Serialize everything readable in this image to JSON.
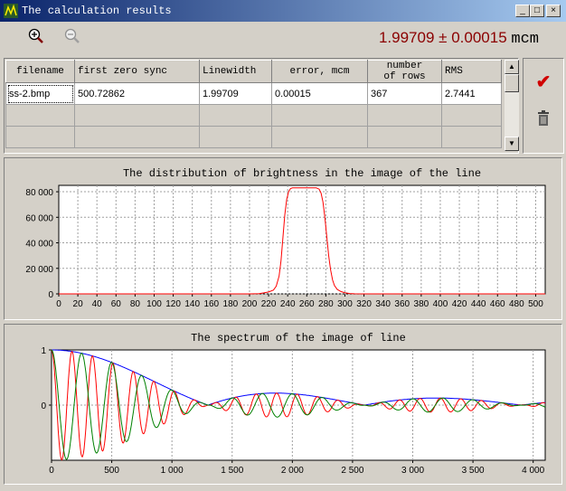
{
  "window": {
    "title": "The calculation results"
  },
  "toolbar": {
    "zoom_in_icon": "zoom-in-icon",
    "zoom_out_icon": "zoom-out-icon",
    "result_value": "1.99709",
    "plus_minus": "± 0.00015",
    "unit": "mcm"
  },
  "table": {
    "headers": [
      "filename",
      "first zero sync",
      "Linewidth",
      "error, mcm",
      "number\nof rows",
      "RMS"
    ],
    "rows": [
      [
        "ss-2.bmp",
        "500.72862",
        "1.99709",
        "0.00015",
        "367",
        "2.7441"
      ]
    ]
  },
  "side": {
    "accept_icon": "check-icon",
    "delete_icon": "trash-icon"
  },
  "chart_data": [
    {
      "type": "line",
      "title": "The distribution of brightness in the image of the line",
      "xlim": [
        0,
        510
      ],
      "ylim": [
        0,
        85000
      ],
      "xticks": [
        0,
        20,
        40,
        60,
        80,
        100,
        120,
        140,
        160,
        180,
        200,
        220,
        240,
        260,
        280,
        300,
        320,
        340,
        360,
        380,
        400,
        420,
        440,
        460,
        480,
        500
      ],
      "yticks": [
        0,
        20000,
        40000,
        60000,
        80000
      ],
      "ytick_labels": [
        "0",
        "20 000",
        "40 000",
        "60 000",
        "80 000"
      ],
      "grid": true,
      "series": [
        {
          "color": "#ff0000",
          "x": [
            0,
            200,
            210,
            215,
            220,
            225,
            228,
            231,
            233,
            235,
            237,
            239,
            241,
            243,
            245,
            247,
            250,
            255,
            260,
            265,
            270,
            273,
            275,
            277,
            279,
            281,
            283,
            285,
            287,
            289,
            292,
            296,
            300,
            305,
            310,
            320,
            340,
            510
          ],
          "y": [
            0,
            0,
            200,
            800,
            1500,
            3000,
            6000,
            14000,
            26000,
            44000,
            62000,
            74000,
            80000,
            82500,
            83000,
            83000,
            83000,
            83000,
            83000,
            83000,
            83000,
            82000,
            79000,
            72000,
            60000,
            45000,
            30000,
            19000,
            11000,
            6500,
            3500,
            1800,
            900,
            300,
            100,
            0,
            0,
            0
          ]
        }
      ]
    },
    {
      "type": "line",
      "title": "The spectrum of the image of line",
      "xlim": [
        0,
        4100
      ],
      "ylim": [
        -1,
        1
      ],
      "xticks": [
        0,
        500,
        1000,
        1500,
        2000,
        2500,
        3000,
        3500,
        4000
      ],
      "xtick_labels": [
        "0",
        "500",
        "1 000",
        "1 500",
        "2 000",
        "2 500",
        "3 000",
        "3 500",
        "4 000"
      ],
      "yticks": [
        1,
        0
      ],
      "ytick_labels": [
        "1",
        "0"
      ],
      "grid": true,
      "series": [
        {
          "color": "#0000ff",
          "curve": "envelope"
        },
        {
          "color": "#ff0000",
          "curve": "cos",
          "period": 170
        },
        {
          "color": "#008000",
          "curve": "cos",
          "period": 250
        }
      ]
    }
  ]
}
